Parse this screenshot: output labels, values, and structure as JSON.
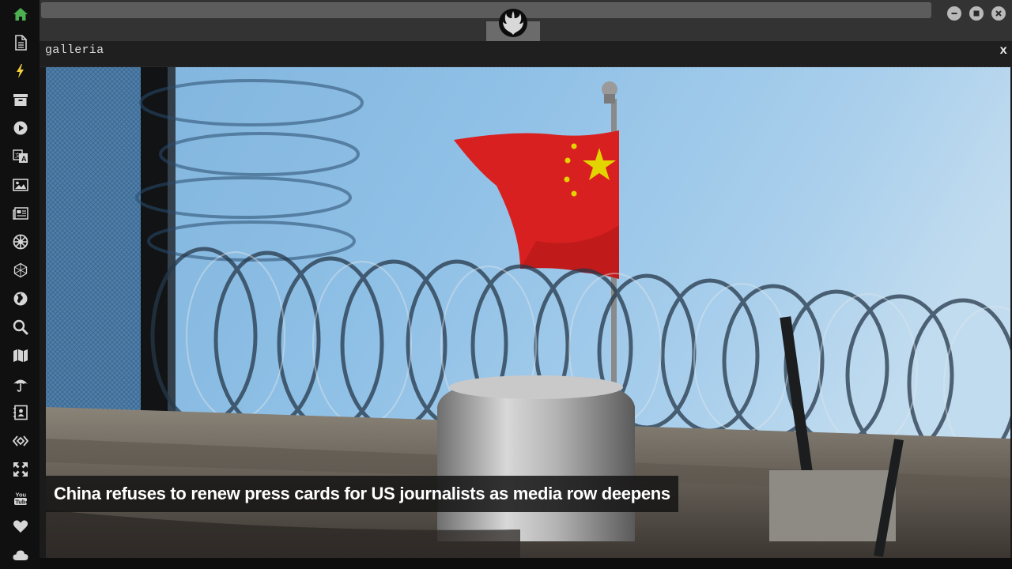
{
  "sidebar": {
    "items": [
      {
        "icon": "home-icon",
        "color": "#4caf50"
      },
      {
        "icon": "document-icon"
      },
      {
        "icon": "lightning-icon",
        "color": "#f4d03f"
      },
      {
        "icon": "archive-icon"
      },
      {
        "icon": "play-icon"
      },
      {
        "icon": "translate-icon"
      },
      {
        "icon": "image-icon"
      },
      {
        "icon": "newspaper-icon"
      },
      {
        "icon": "empire-icon"
      },
      {
        "icon": "hexagon-network-icon"
      },
      {
        "icon": "globe-icon"
      },
      {
        "icon": "search-icon"
      },
      {
        "icon": "map-icon"
      },
      {
        "icon": "umbrella-icon"
      },
      {
        "icon": "contact-card-icon"
      },
      {
        "icon": "code-diamond-icon"
      },
      {
        "icon": "expand-arrows-icon"
      },
      {
        "icon": "youtube-icon",
        "text": "You Tube"
      },
      {
        "icon": "heart-icon"
      },
      {
        "icon": "cloud-icon"
      }
    ]
  },
  "topbar": {
    "logo": "rebel-alliance-icon",
    "window_buttons": [
      "minimize-icon",
      "maximize-icon",
      "close-icon"
    ]
  },
  "gallery": {
    "title": "galleria",
    "close_label": "x",
    "caption": "China refuses to renew press cards for US journalists as media row deepens",
    "image_subject": "flag-behind-razor-wire-photo"
  },
  "colors": {
    "sidebar_bg": "#101010",
    "topbar_bg": "#333333",
    "accent_green": "#4caf50",
    "accent_yellow": "#f4d03f",
    "icon_default": "#d6d6d6"
  }
}
